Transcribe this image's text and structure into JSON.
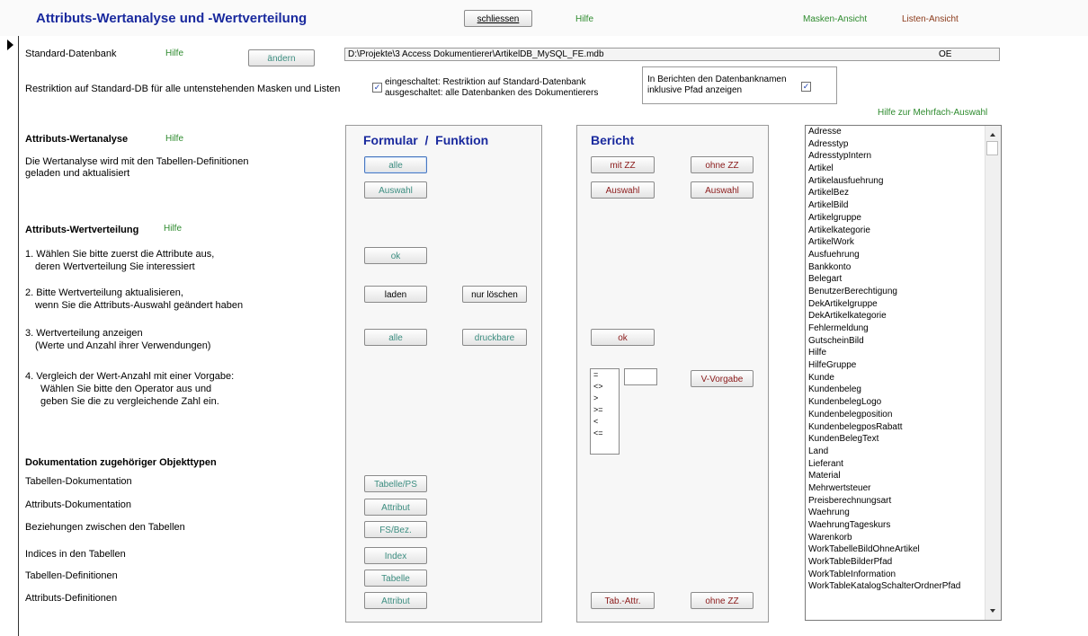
{
  "header": {
    "title": "Attributs-Wertanalyse und -Wertverteilung",
    "close_button": "schliessen",
    "help": "Hilfe",
    "mask_view": "Masken-Ansicht",
    "list_view": "Listen-Ansicht"
  },
  "standard_db": {
    "label": "Standard-Datenbank",
    "help": "Hilfe",
    "change_button": "ändern",
    "path": "D:\\Projekte\\3 Access Dokumentierer\\ArtikelDB_MySQL_FE.mdb",
    "code": "OE"
  },
  "restriction": {
    "label": "Restriktion auf Standard-DB für alle untenstehenden Masken und Listen",
    "checked": true,
    "line1": "eingeschaltet: Restriktion auf Standard-Datenbank",
    "line2": "ausgeschaltet: alle Datenbanken des Dokumentierers"
  },
  "report_option": {
    "line1": "In Berichten den Datenbanknamen",
    "line2": "inklusive Pfad anzeigen",
    "checked": true
  },
  "multi_select_help": "Hilfe zur Mehrfach-Auswahl",
  "panels": {
    "form_title_a": "Formular",
    "form_title_sep": "/",
    "form_title_b": "Funktion",
    "report_title": "Bericht"
  },
  "analysis": {
    "heading": "Attributs-Wertanalyse",
    "help": "Hilfe",
    "text1": "Die Wertanalyse wird mit den Tabellen-Definitionen",
    "text2": "geladen und  aktualisiert",
    "btn_all": "alle",
    "btn_selection": "Auswahl",
    "btn_with_zz": "mit ZZ",
    "btn_without_zz": "ohne ZZ",
    "btn_report_selection1": "Auswahl",
    "btn_report_selection2": "Auswahl"
  },
  "distribution": {
    "heading": "Attributs-Wertverteilung",
    "help": "Hilfe",
    "step1_a": "1. Wählen Sie bitte zuerst die Attribute aus,",
    "step1_b": "deren Wertverteilung Sie interessiert",
    "step1_btn": "ok",
    "step2_a": "2. Bitte Wertverteilung aktualisieren,",
    "step2_b": "wenn Sie die Attributs-Auswahl geändert haben",
    "step2_btn_load": "laden",
    "step2_btn_delete": "nur löschen",
    "step3_a": "3. Wertverteilung anzeigen",
    "step3_b": "(Werte und Anzahl ihrer Verwendungen)",
    "step3_btn_all": "alle",
    "step3_btn_print": "druckbare",
    "step3_btn_ok": "ok",
    "step4_a": "4. Vergleich der Wert-Anzahl mit einer Vorgabe:",
    "step4_b": "Wählen Sie bitte den Operator aus und",
    "step4_c": "geben Sie die zu vergleichende Zahl ein.",
    "operators": [
      "=",
      "<>",
      ">",
      ">=",
      "<",
      "<="
    ],
    "compare_value": "",
    "vorgabe_btn": "V-Vorgabe"
  },
  "documentation": {
    "heading": "Dokumentation zugehöriger Objekttypen",
    "rows": [
      {
        "label": "Tabellen-Dokumentation",
        "btn": "Tabelle/PS"
      },
      {
        "label": "Attributs-Dokumentation",
        "btn": "Attribut"
      },
      {
        "label": "Beziehungen zwischen den Tabellen",
        "btn": "FS/Bez."
      },
      {
        "label": "Indices in den Tabellen",
        "btn": "Index"
      },
      {
        "label": "Tabellen-Definitionen",
        "btn": "Tabelle"
      },
      {
        "label": "Attributs-Definitionen",
        "btn": "Attribut"
      }
    ],
    "report_tab_attr": "Tab.-Attr.",
    "report_without_zz": "ohne ZZ"
  },
  "tables": [
    "Adresse",
    "Adresstyp",
    "AdresstypIntern",
    "Artikel",
    "Artikelausfuehrung",
    "ArtikelBez",
    "ArtikelBild",
    "Artikelgruppe",
    "Artikelkategorie",
    "ArtikelWork",
    "Ausfuehrung",
    "Bankkonto",
    "Belegart",
    "BenutzerBerechtigung",
    "DekArtikelgruppe",
    "DekArtikelkategorie",
    "Fehlermeldung",
    "GutscheinBild",
    "Hilfe",
    "HilfeGruppe",
    "Kunde",
    "Kundenbeleg",
    "KundenbelegLogo",
    "Kundenbelegposition",
    "KundenbelegposRabatt",
    "KundenBelegText",
    "Land",
    "Lieferant",
    "Material",
    "Mehrwertsteuer",
    "Preisberechnungsart",
    "Waehrung",
    "WaehrungTageskurs",
    "Warenkorb",
    "WorkTabelleBildOhneArtikel",
    "WorkTableBilderPfad",
    "WorkTableInformation",
    "WorkTableKatalogSchalterOrdnerPfad"
  ]
}
